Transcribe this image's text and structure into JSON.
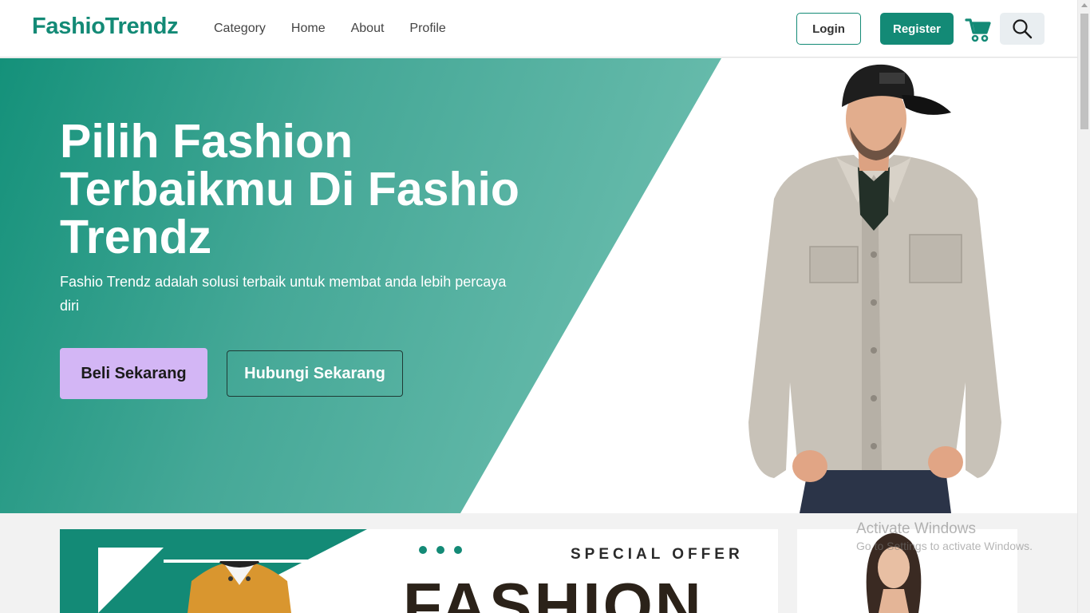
{
  "navbar": {
    "brand": "FashioTrendz",
    "links": [
      "Category",
      "Home",
      "About",
      "Profile"
    ],
    "login_label": "Login",
    "register_label": "Register",
    "cart_icon": "cart-icon",
    "search_icon": "search-icon"
  },
  "hero": {
    "title": "Pilih Fashion Terbaikmu Di Fashio Trendz",
    "subtitle": "Fashio Trendz adalah solusi terbaik untuk membat anda lebih percaya diri",
    "buy_label": "Beli Sekarang",
    "contact_label": "Hubungi Sekarang"
  },
  "promo": {
    "special_label": "SPECIAL OFFER",
    "big_label": "FASHION"
  },
  "watermark": {
    "title": "Activate Windows",
    "subtitle": "Go to Settings to activate Windows."
  },
  "colors": {
    "brand": "#138a76",
    "buy_button": "#d3b6f5",
    "search_bg": "#e9eef1"
  }
}
